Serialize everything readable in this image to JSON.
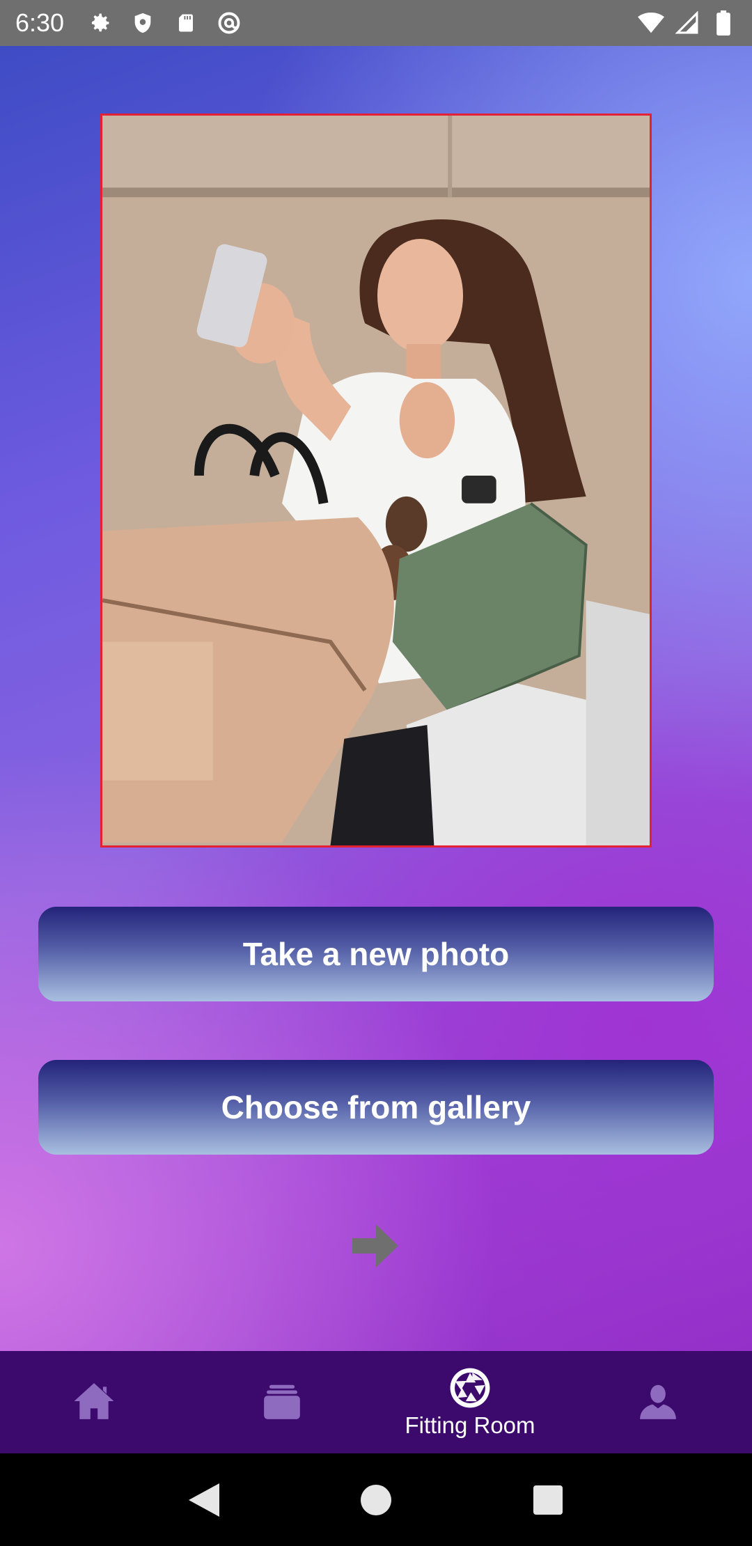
{
  "status_bar": {
    "time": "6:30",
    "left_icons": [
      "gear-icon",
      "shield-icon",
      "sd-card-icon",
      "at-sign-icon"
    ],
    "right_icons": [
      "wifi-icon",
      "signal-icon",
      "battery-icon"
    ]
  },
  "photo": {
    "border_color": "#e32034"
  },
  "buttons": {
    "take_photo": "Take a new photo",
    "gallery": "Choose from gallery"
  },
  "bottom_nav": {
    "items": [
      {
        "icon": "home-icon",
        "label": ""
      },
      {
        "icon": "cards-icon",
        "label": ""
      },
      {
        "icon": "camera-aperture-icon",
        "label": "Fitting Room"
      },
      {
        "icon": "profile-icon",
        "label": ""
      }
    ],
    "active_index": 2,
    "inactive_color": "#8f6bc0",
    "active_color": "#ffffff"
  },
  "system_nav": [
    "back-icon",
    "home-circle-icon",
    "recents-icon"
  ]
}
